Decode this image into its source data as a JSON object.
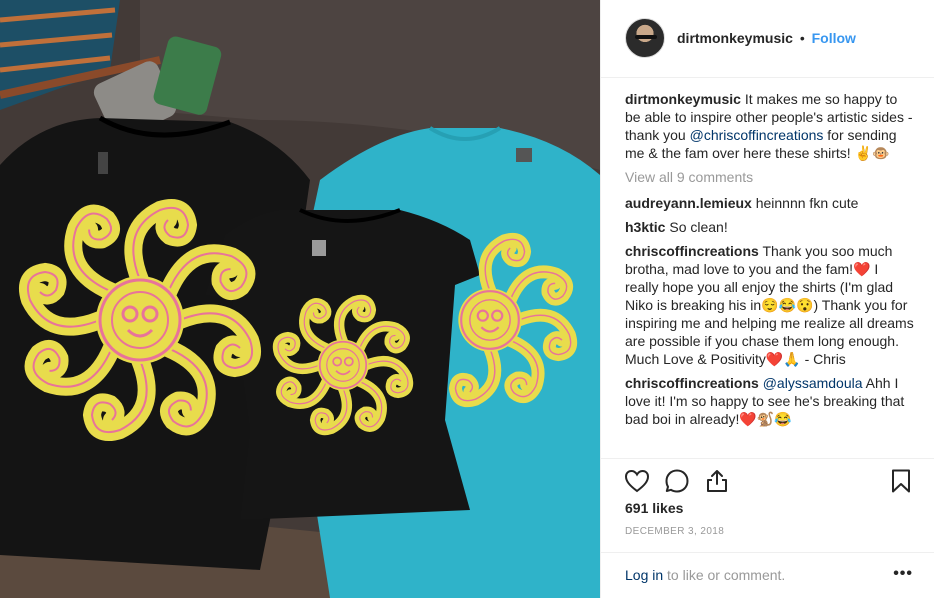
{
  "post": {
    "author": "dirtmonkeymusic",
    "separator": "•",
    "follow_label": "Follow",
    "caption_user": "dirtmonkeymusic",
    "caption_pre": " It makes me so happy to be able to inspire other people's artistic sides - thank you ",
    "caption_mention": "@chriscoffincreations",
    "caption_post": " for sending me & the fam over here these shirts! ✌️🐵",
    "view_all": "View all 9 comments",
    "likes": "691 likes",
    "date": "DECEMBER 3, 2018"
  },
  "comments": [
    {
      "user": "audreyann.lemieux",
      "text": " heinnnn fkn cute"
    },
    {
      "user": "h3ktic",
      "text": " So clean!"
    },
    {
      "user": "chriscoffincreations",
      "text": " Thank you soo much brotha, mad love to you and the fam!❤️ I really hope you all enjoy the shirts (I'm glad Niko is breaking his in😌😂😯) Thank you for inspiring me and helping me realize all dreams are possible if you chase them long enough. Much Love & Positivity❤️🙏 - Chris"
    },
    {
      "user": "chriscoffincreations",
      "mention": "@alyssamdoula",
      "text": " Ahh I love it! I'm so happy to see he's breaking that bad boi in already!❤️🐒😂"
    }
  ],
  "footer": {
    "login_label": "Log in",
    "login_rest": " to like or comment.",
    "more_label": "•••"
  },
  "icons": {
    "like": "heart-icon",
    "comment": "comment-icon",
    "share": "share-icon",
    "save": "bookmark-icon"
  },
  "colors": {
    "follow": "#3897f0",
    "mention": "#003569",
    "muted": "#999999",
    "shirt_black": "#141414",
    "shirt_teal": "#2fb3c9",
    "print_yellow": "#e8dc4c",
    "print_pink": "#e8739a"
  }
}
